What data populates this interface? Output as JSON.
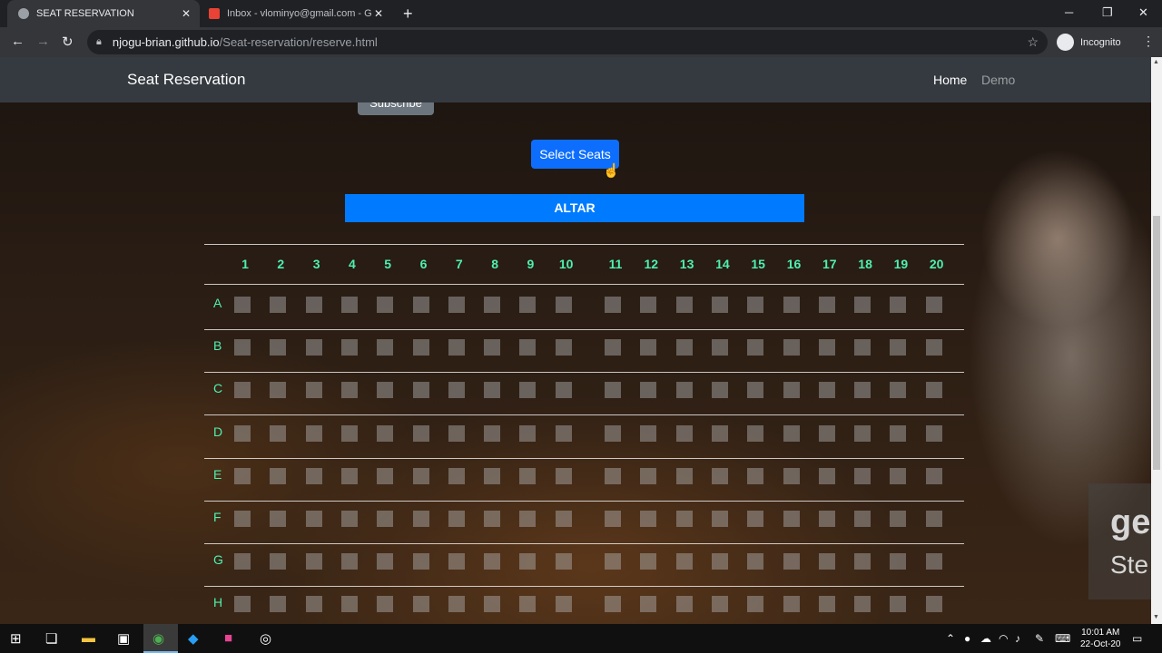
{
  "browser": {
    "tabs": [
      {
        "title": "SEAT RESERVATION",
        "active": true
      },
      {
        "title": "Inbox - vlominyo@gmail.com - Gm",
        "active": false
      }
    ],
    "url_host": "njogu-brian.github.io",
    "url_path": "/Seat-reservation/reserve.html",
    "profile_label": "Incognito"
  },
  "page": {
    "brand": "Seat Reservation",
    "nav": {
      "home": "Home",
      "demo": "Demo"
    },
    "subscribe_label": "Subscribe",
    "select_seats_label": "Select Seats",
    "altar_label": "ALTAR",
    "columns": [
      "1",
      "2",
      "3",
      "4",
      "5",
      "6",
      "7",
      "8",
      "9",
      "10",
      "11",
      "12",
      "13",
      "14",
      "15",
      "16",
      "17",
      "18",
      "19",
      "20"
    ],
    "rows": [
      "A",
      "B",
      "C",
      "D",
      "E",
      "F",
      "G",
      "H"
    ]
  },
  "watermark": {
    "line1": "ge",
    "line2": "Ste"
  },
  "taskbar": {
    "time": "10:01 AM",
    "date": "22-Oct-20"
  }
}
